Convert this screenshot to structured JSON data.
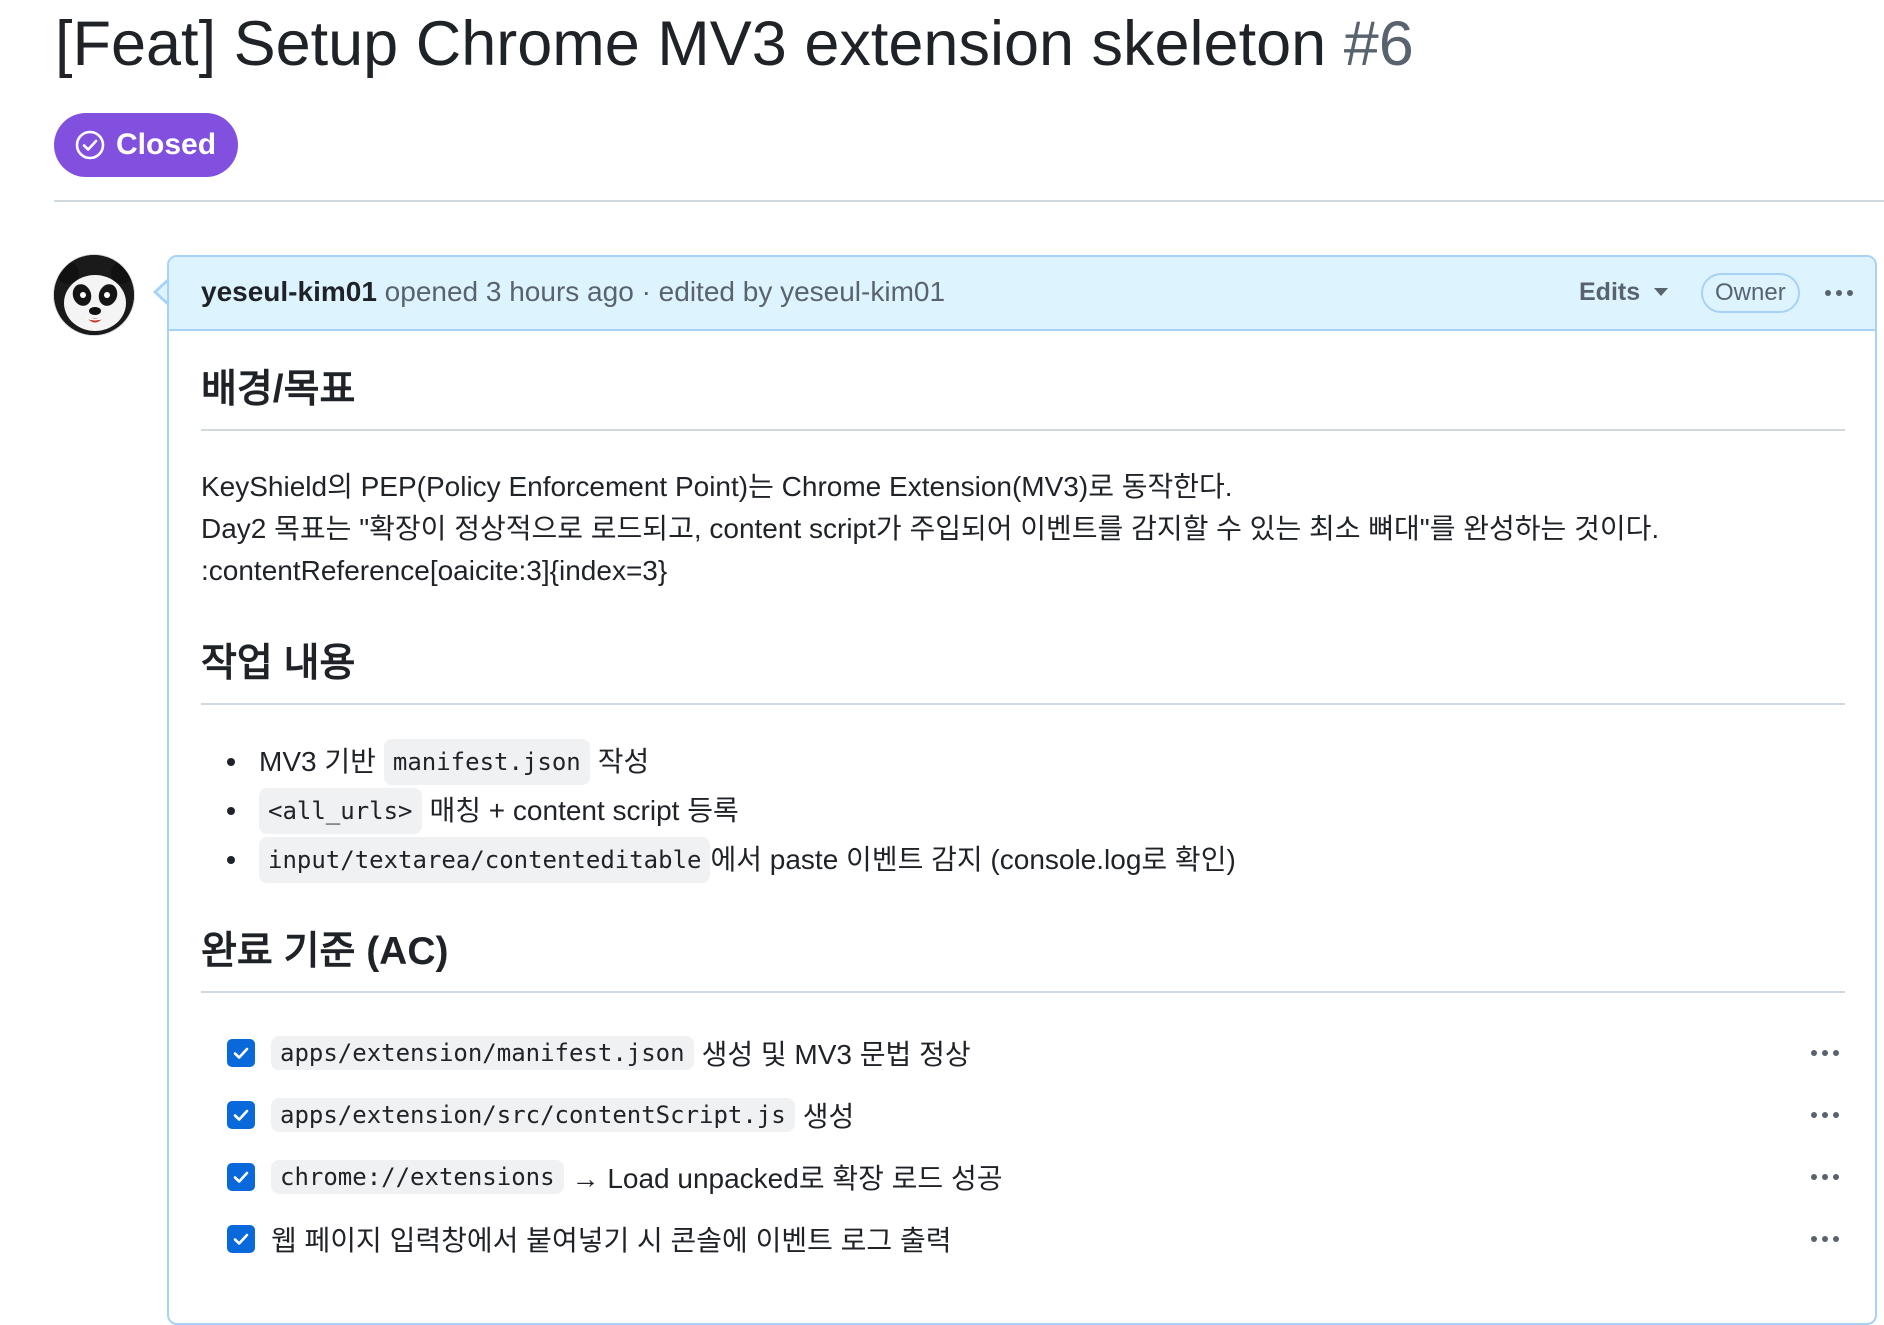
{
  "issue": {
    "title": "[Feat] Setup Chrome MV3 extension skeleton",
    "number": "#6",
    "state": "Closed",
    "state_color": "#8250df"
  },
  "comment": {
    "author": "yeseul-kim01",
    "action": "opened 3 hours ago",
    "separator": "·",
    "edited_by": "edited by yeseul-kim01",
    "edits_label": "Edits",
    "role_badge": "Owner",
    "avatar_icon": "panda-avatar-icon",
    "more_icon": "kebab-horizontal-icon"
  },
  "body": {
    "section1": {
      "heading": "배경/목표",
      "lines": [
        "KeyShield의 PEP(Policy Enforcement Point)는 Chrome Extension(MV3)로 동작한다.",
        "Day2 목표는 \"확장이 정상적으로 로드되고, content script가 주입되어 이벤트를 감지할 수 있는 최소 뼈대\"를 완성하는 것이다.",
        ":contentReference[oaicite:3]{index=3}"
      ]
    },
    "section2": {
      "heading": "작업 내용",
      "bullets": [
        {
          "before": "MV3 기반",
          "code": "manifest.json",
          "after": "작성"
        },
        {
          "before": "",
          "code": "<all_urls>",
          "after": "매칭 + content script 등록"
        },
        {
          "before": "",
          "code": "input/textarea/contenteditable",
          "after": "에서 paste 이벤트 감지 (console.log로 확인)"
        }
      ]
    },
    "section3": {
      "heading": "완료 기준 (AC)",
      "tasks": [
        {
          "checked": true,
          "code": "apps/extension/manifest.json",
          "text": "생성 및 MV3 문법 정상"
        },
        {
          "checked": true,
          "code": "apps/extension/src/contentScript.js",
          "text": "생성"
        },
        {
          "checked": true,
          "code": "chrome://extensions",
          "text": "→ Load unpacked로 확장 로드 성공"
        },
        {
          "checked": true,
          "code": "",
          "text": "웹 페이지 입력창에서 붙여넣기 시 콘솔에 이벤트 로그 출력"
        }
      ]
    }
  },
  "colors": {
    "accent_blue": "#0969da",
    "header_bg": "#ddf4ff",
    "border_blue": "#a8d2f5",
    "muted_text": "#59636e"
  }
}
